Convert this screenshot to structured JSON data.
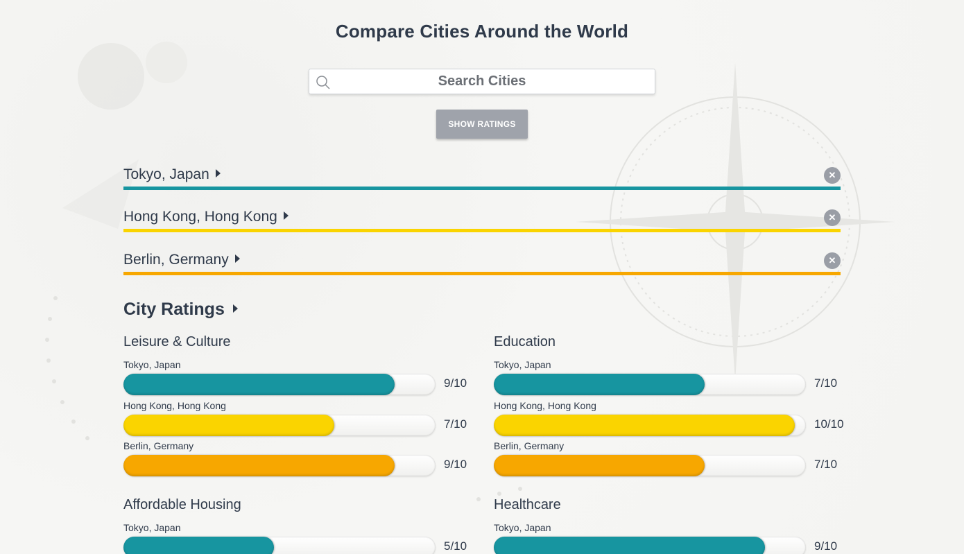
{
  "page": {
    "title": "Compare Cities Around the World"
  },
  "search": {
    "placeholder": "Search Cities",
    "value": ""
  },
  "show_ratings_label": "SHOW RATINGS",
  "colors": {
    "tokyo": "#1795a0",
    "hong_kong": "#fad400",
    "berlin": "#f7a700"
  },
  "cities": [
    {
      "name": "Tokyo, Japan",
      "color": "#1795a0"
    },
    {
      "name": "Hong Kong, Hong Kong",
      "color": "#fad400"
    },
    {
      "name": "Berlin, Germany",
      "color": "#f7a700"
    }
  ],
  "ratings": {
    "heading": "City Ratings",
    "categories": [
      {
        "title": "Leisure & Culture",
        "entries": [
          {
            "city": "Tokyo, Japan",
            "score": 9,
            "label": "9/10",
            "color": "#1795a0"
          },
          {
            "city": "Hong Kong, Hong Kong",
            "score": 7,
            "label": "7/10",
            "color": "#fad400"
          },
          {
            "city": "Berlin, Germany",
            "score": 9,
            "label": "9/10",
            "color": "#f7a700"
          }
        ]
      },
      {
        "title": "Education",
        "entries": [
          {
            "city": "Tokyo, Japan",
            "score": 7,
            "label": "7/10",
            "color": "#1795a0"
          },
          {
            "city": "Hong Kong, Hong Kong",
            "score": 10,
            "label": "10/10",
            "color": "#fad400"
          },
          {
            "city": "Berlin, Germany",
            "score": 7,
            "label": "7/10",
            "color": "#f7a700"
          }
        ]
      },
      {
        "title": "Affordable Housing",
        "entries": [
          {
            "city": "Tokyo, Japan",
            "score": 5,
            "label": "5/10",
            "color": "#1795a0"
          }
        ]
      },
      {
        "title": "Healthcare",
        "entries": [
          {
            "city": "Tokyo, Japan",
            "score": 9,
            "label": "9/10",
            "color": "#1795a0"
          }
        ]
      }
    ]
  }
}
